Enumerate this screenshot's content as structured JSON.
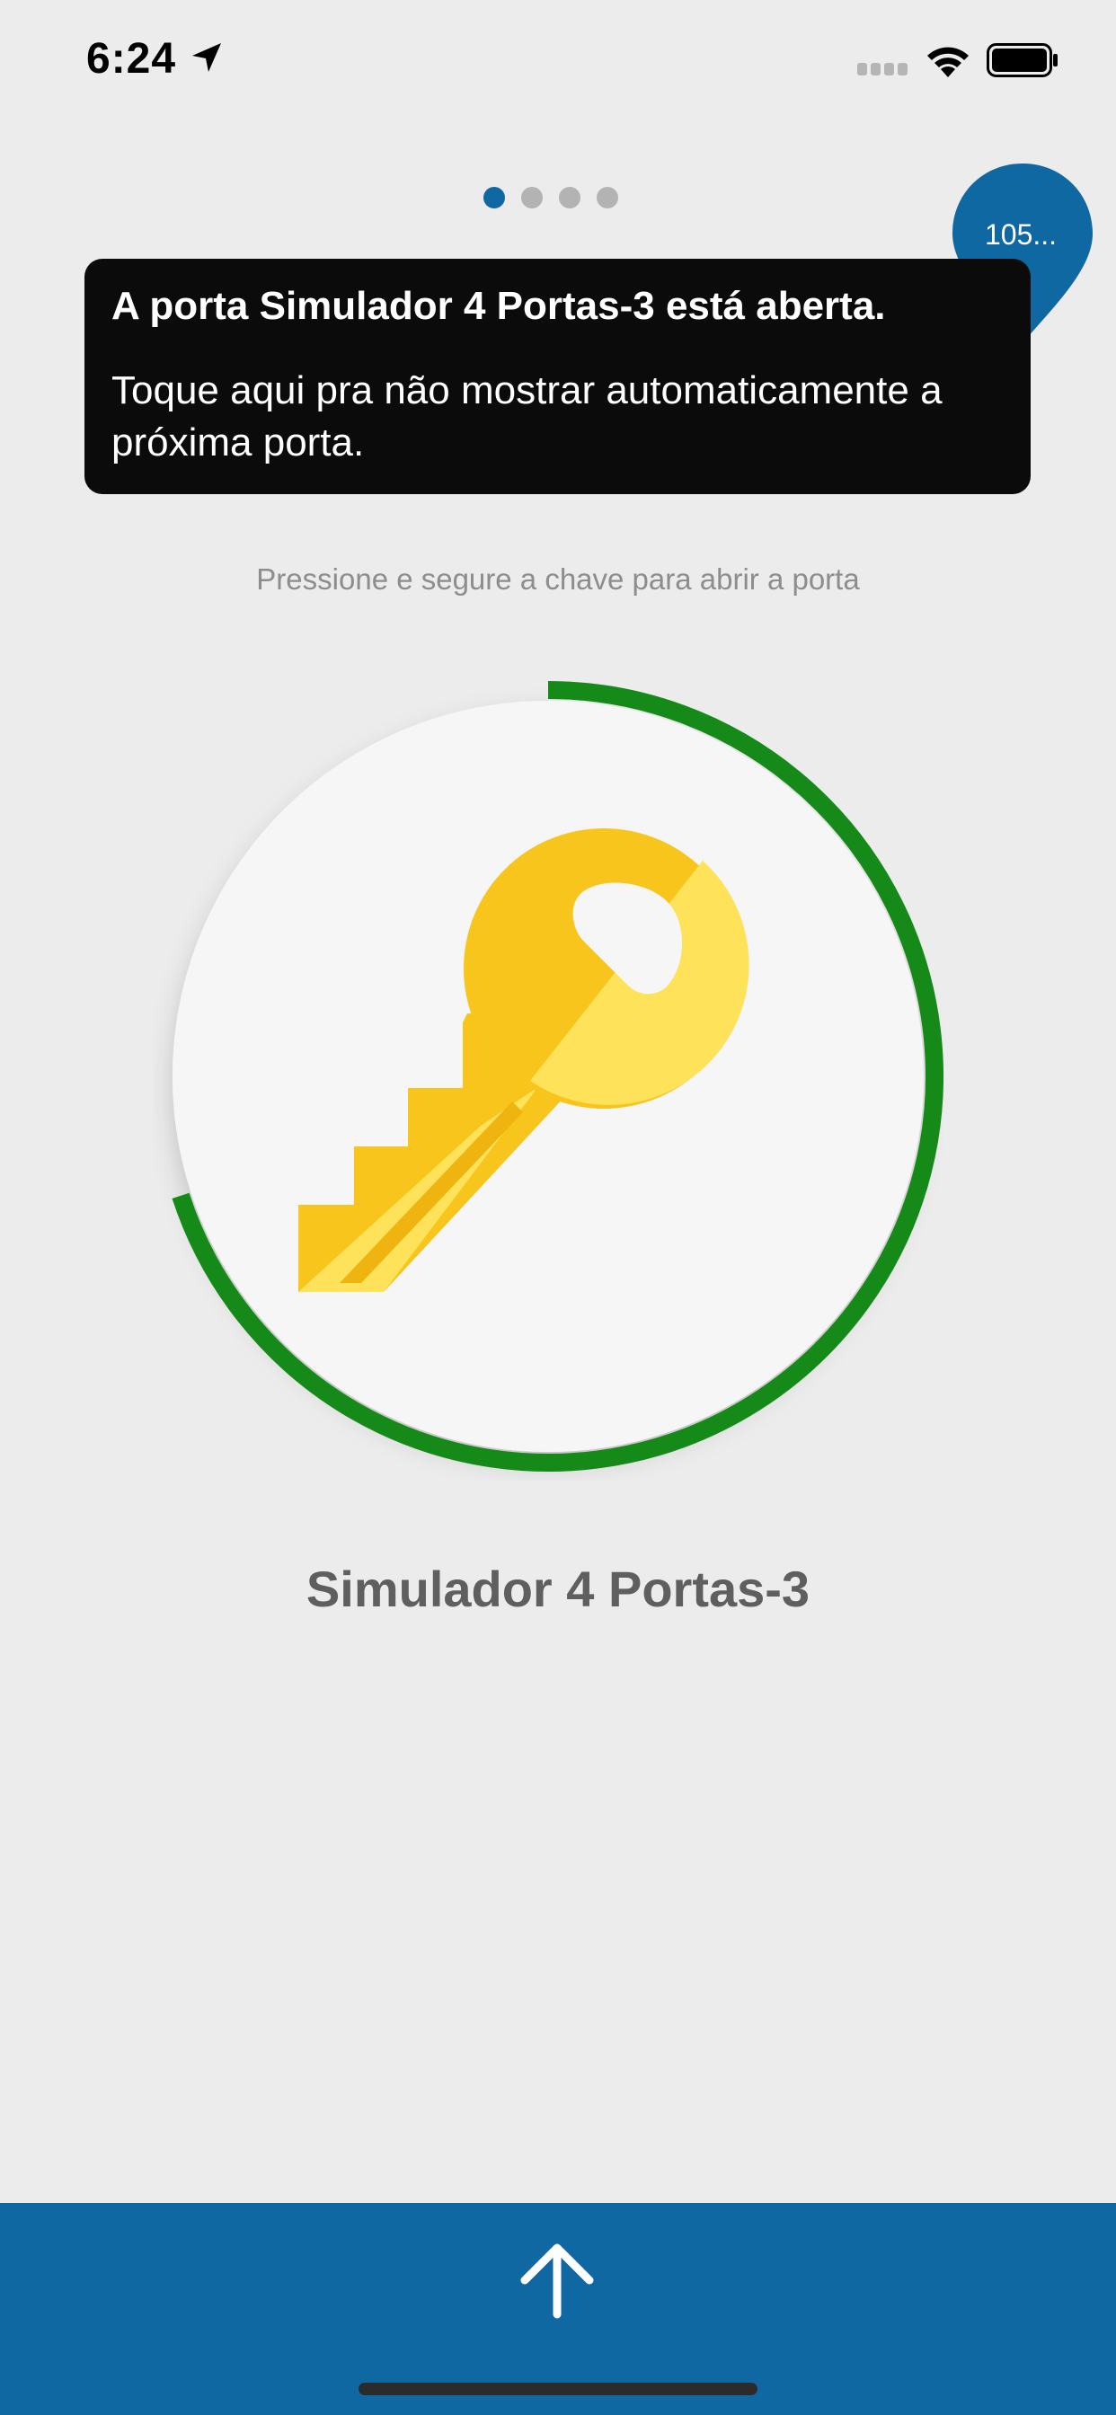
{
  "status_bar": {
    "time": "6:24"
  },
  "colors": {
    "accent": "#1068a3",
    "progress": "#168a18",
    "key_dark": "#f7c51c",
    "key_light": "#fde25a"
  },
  "pager": {
    "count": 4,
    "active": 0
  },
  "map_pin": {
    "label": "105..."
  },
  "toast": {
    "title": "A porta Simulador 4 Portas-3 está aberta.",
    "message": "Toque aqui pra não mostrar automaticamente a próxima porta."
  },
  "instruction": "Pressione e segure a chave para abrir a porta",
  "door": {
    "name": "Simulador 4 Portas-3",
    "hold_progress": 0.7
  },
  "icons": [
    "location-arrow-icon",
    "signal-icon",
    "wifi-icon",
    "battery-icon",
    "key-icon",
    "arrow-up-icon"
  ]
}
